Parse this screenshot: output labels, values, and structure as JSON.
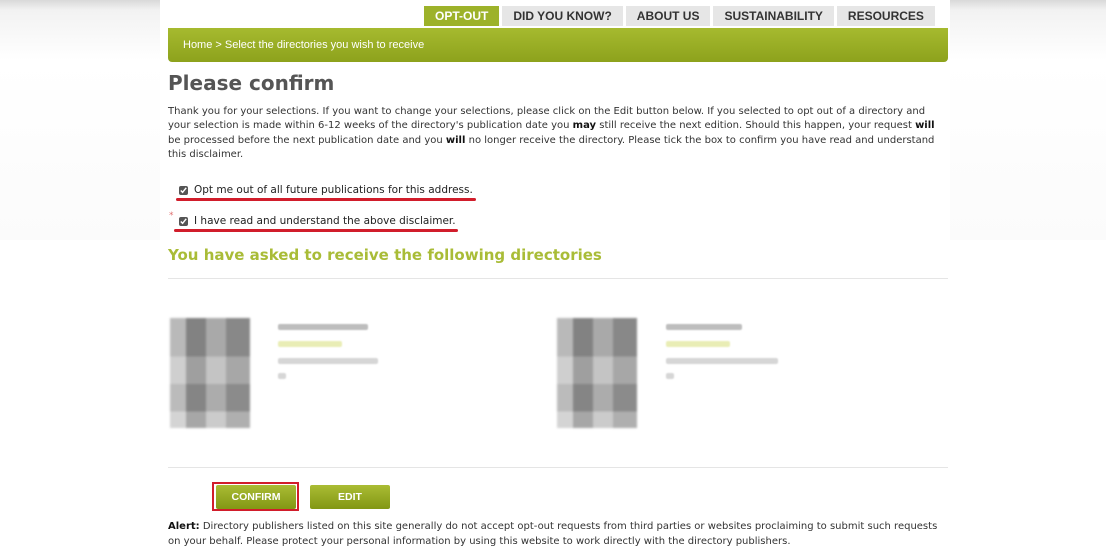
{
  "nav": {
    "tabs": [
      {
        "label": "OPT-OUT",
        "active": true
      },
      {
        "label": "DID YOU KNOW?",
        "active": false
      },
      {
        "label": "ABOUT US",
        "active": false
      },
      {
        "label": "SUSTAINABILITY",
        "active": false
      },
      {
        "label": "RESOURCES",
        "active": false
      }
    ]
  },
  "breadcrumb": "Home > Select the directories you wish to receive",
  "page_title": "Please confirm",
  "intro": {
    "part1": "Thank you for your selections. If you want to change your selections, please click on the Edit button below. If you selected to opt out of a directory and your selection is made within 6-12 weeks of the directory's publication date you ",
    "bold1": "may",
    "part2": " still receive the next edition. Should this happen, your request ",
    "bold2": "will",
    "part3": " be processed before the next publication date and you ",
    "bold3": "will",
    "part4": " no longer receive the directory. Please tick the box to confirm you have read and understand this disclaimer."
  },
  "checkboxes": {
    "opt_out_all": {
      "label": "Opt me out of all future publications for this address.",
      "checked": true
    },
    "disclaimer": {
      "label": "I have read and understand the above disclaimer.",
      "checked": true,
      "required_mark": "*"
    }
  },
  "section_heading": "You have asked to receive the following directories",
  "buttons": {
    "confirm": "CONFIRM",
    "edit": "EDIT"
  },
  "alert": {
    "label": "Alert:",
    "text": " Directory publishers listed on this site generally do not accept opt-out requests from third parties or websites proclaiming to submit such requests on your behalf. Please protect your personal information by using this website to work directly with the directory publishers."
  },
  "colors": {
    "accent_green": "#9db22a",
    "highlight_red": "#d11d2b",
    "heading_green": "#a9bc37"
  }
}
